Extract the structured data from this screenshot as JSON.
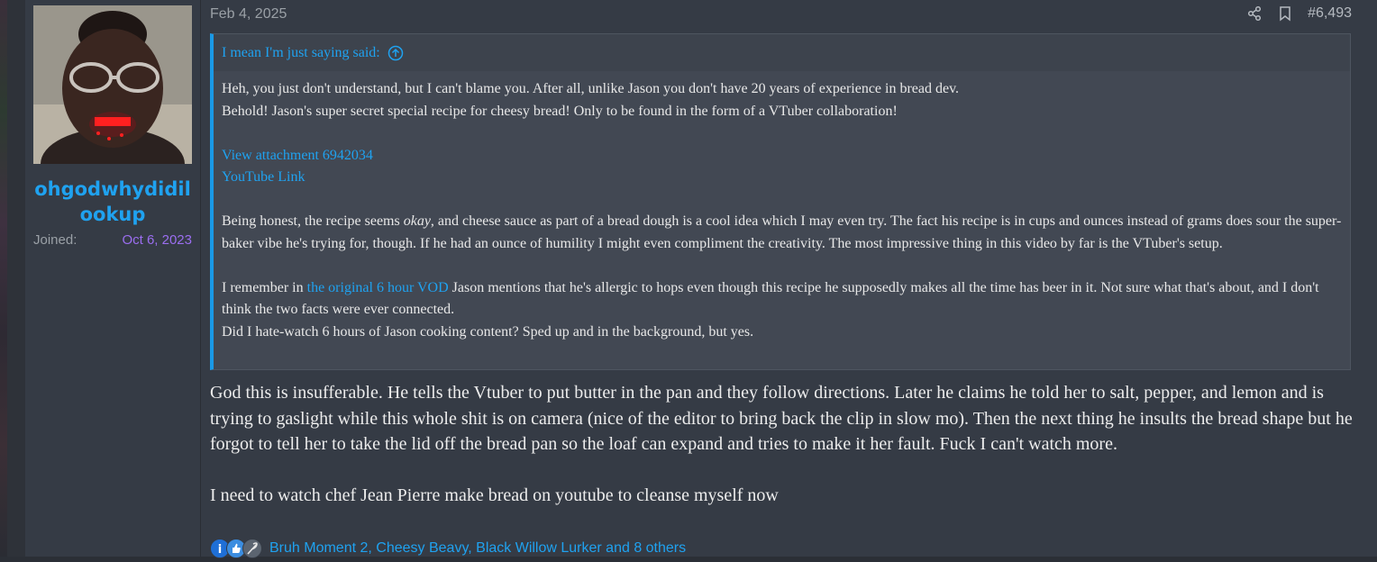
{
  "user": {
    "username": "ohgodwhydidilookup",
    "joined_label": "Joined:",
    "joined_date": "Oct 6, 2023"
  },
  "post": {
    "date": "Feb 4, 2025",
    "number": "#6,493",
    "quote": {
      "header": "I mean I'm just saying said:",
      "line1": "Heh, you just don't understand, but I can't blame you. After all, unlike Jason you don't have 20 years of experience in bread dev.",
      "line2": "Behold! Jason's super secret special recipe for cheesy bread! Only to be found in the form of a VTuber collaboration!",
      "attachment_link": "View attachment 6942034",
      "youtube_link": "YouTube Link",
      "para2_before": "Being honest, the recipe seems ",
      "para2_em": "okay",
      "para2_after": ", and cheese sauce as part of a bread dough is a cool idea which I may even try. The fact his recipe is in cups and ounces instead of grams does sour the super-baker vibe he's trying for, though. If he had an ounce of humility I might even compliment the creativity. The most impressive thing in this video by far is the VTuber's setup.",
      "para3_before": "I remember in ",
      "para3_link": "the original 6 hour VOD",
      "para3_after": " Jason mentions that he's allergic to hops even though this recipe he supposedly makes all the time has beer in it. Not sure what that's about, and I don't think the two facts were ever connected.",
      "para3_last": "Did I hate-watch 6 hours of Jason cooking content? Sped up and in the background, but yes."
    },
    "reply": {
      "para1": "God this is insufferable. He tells the Vtuber to put butter in the pan and they follow directions. Later he claims he told her to salt, pepper, and lemon and is trying to gaslight while this whole shit is on camera (nice of the editor to bring back the clip in slow mo). Then the next thing he insults the bread shape but he forgot to tell her to take the lid off the bread pan so the loaf can expand and tries to make it her fault. Fuck I can't watch more.",
      "para2": "I need to watch chef Jean Pierre make bread on youtube to cleanse myself now"
    },
    "reactions": {
      "text": "Bruh Moment 2, Cheesy Beavy, Black Willow Lurker and 8 others",
      "icons": [
        "info-icon",
        "thumbs-up-icon",
        "feather-icon"
      ]
    }
  },
  "colors": {
    "accent": "#1fa2f0",
    "joined_date": "#9b6ef0",
    "quote_border": "#1a99e6",
    "panel_bg": "#353b45"
  }
}
